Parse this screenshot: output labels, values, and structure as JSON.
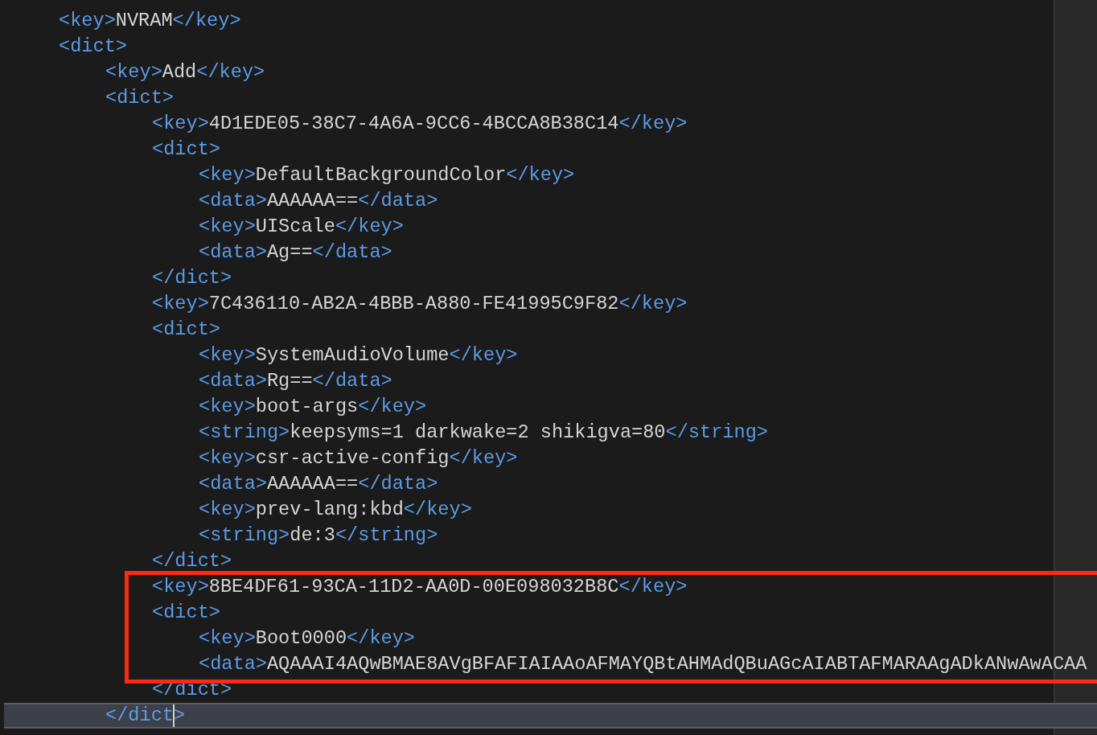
{
  "editor": {
    "lines": [
      {
        "open": "<key>",
        "value": "NVRAM",
        "close": "</key>"
      },
      {
        "open": "<dict>",
        "children": [
          {
            "open": "<key>",
            "value": "Add",
            "close": "</key>"
          },
          {
            "open": "<dict>",
            "close_current": true,
            "close": "</dict>",
            "children": [
              {
                "open": "<key>",
                "value": "4D1EDE05-38C7-4A6A-9CC6-4BCCA8B38C14",
                "close": "</key>"
              },
              {
                "open": "<dict>",
                "close": "</dict>",
                "children": [
                  {
                    "open": "<key>",
                    "value": "DefaultBackgroundColor",
                    "close": "</key>"
                  },
                  {
                    "open": "<data>",
                    "value": "AAAAAA==",
                    "close": "</data>"
                  },
                  {
                    "open": "<key>",
                    "value": "UIScale",
                    "close": "</key>"
                  },
                  {
                    "open": "<data>",
                    "value": "Ag==",
                    "close": "</data>"
                  }
                ]
              },
              {
                "open": "<key>",
                "value": "7C436110-AB2A-4BBB-A880-FE41995C9F82",
                "close": "</key>"
              },
              {
                "open": "<dict>",
                "close": "</dict>",
                "children": [
                  {
                    "open": "<key>",
                    "value": "SystemAudioVolume",
                    "close": "</key>"
                  },
                  {
                    "open": "<data>",
                    "value": "Rg==",
                    "close": "</data>"
                  },
                  {
                    "open": "<key>",
                    "value": "boot-args",
                    "close": "</key>"
                  },
                  {
                    "open": "<string>",
                    "value": "keepsyms=1 darkwake=2 shikigva=80",
                    "close": "</string>"
                  },
                  {
                    "open": "<key>",
                    "value": "csr-active-config",
                    "close": "</key>"
                  },
                  {
                    "open": "<data>",
                    "value": "AAAAAA==",
                    "close": "</data>"
                  },
                  {
                    "open": "<key>",
                    "value": "prev-lang:kbd",
                    "close": "</key>"
                  },
                  {
                    "open": "<string>",
                    "value": "de:3",
                    "close": "</string>"
                  }
                ]
              },
              {
                "open": "<key>",
                "value": "8BE4DF61-93CA-11D2-AA0D-00E098032B8C",
                "close": "</key>",
                "boxed": true
              },
              {
                "open": "<dict>",
                "close": "</dict>",
                "boxed": true,
                "children": [
                  {
                    "open": "<key>",
                    "value": "Boot0000",
                    "close": "</key>"
                  },
                  {
                    "open": "<data>",
                    "value": "AQAAAI4AQwBMAE8AVgBFAFIAIAAoAFMAYQBtAHMAdQBuAGcAIABTAFMARAAgADkANwAwACAA"
                  }
                ]
              }
            ]
          }
        ]
      }
    ]
  }
}
